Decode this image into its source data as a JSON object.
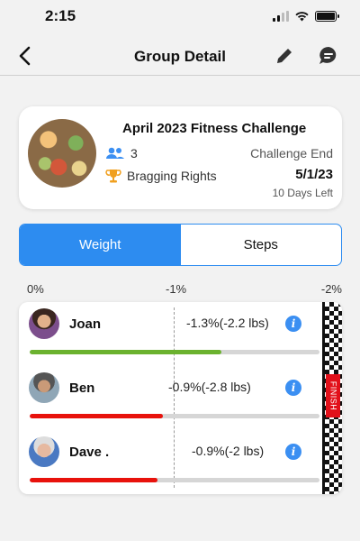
{
  "status_bar": {
    "time": "2:15"
  },
  "nav": {
    "title": "Group Detail"
  },
  "challenge": {
    "title": "April 2023 Fitness Challenge",
    "member_count": "3",
    "prize": "Bragging Rights",
    "end_label": "Challenge End",
    "end_date": "5/1/23",
    "days_left": "10 Days Left"
  },
  "tabs": [
    {
      "label": "Weight",
      "active": true
    },
    {
      "label": "Steps",
      "active": false
    }
  ],
  "scale": {
    "left": "0%",
    "mid": "-1%",
    "right": "-2%"
  },
  "finish_label": "FINISH",
  "members": [
    {
      "name": "Joan",
      "stat": "-1.3%(-2.2 lbs)",
      "progress": 0.66,
      "bar_color": "#6bb22f"
    },
    {
      "name": "Ben",
      "stat": "-0.9%(-2.8 lbs)",
      "progress": 0.46,
      "bar_color": "#e8120c"
    },
    {
      "name": "Dave .",
      "stat": "-0.9%(-2 lbs)",
      "progress": 0.44,
      "bar_color": "#e8120c"
    }
  ],
  "colors": {
    "accent": "#2d8cf0",
    "icon_blue": "#3b8ff2",
    "trophy": "#f0a020"
  },
  "icons": {
    "back": "chevron-left-icon",
    "edit": "pencil-icon",
    "chat": "chat-bubble-icon",
    "members": "group-icon",
    "prize": "trophy-icon",
    "info": "info-icon"
  }
}
